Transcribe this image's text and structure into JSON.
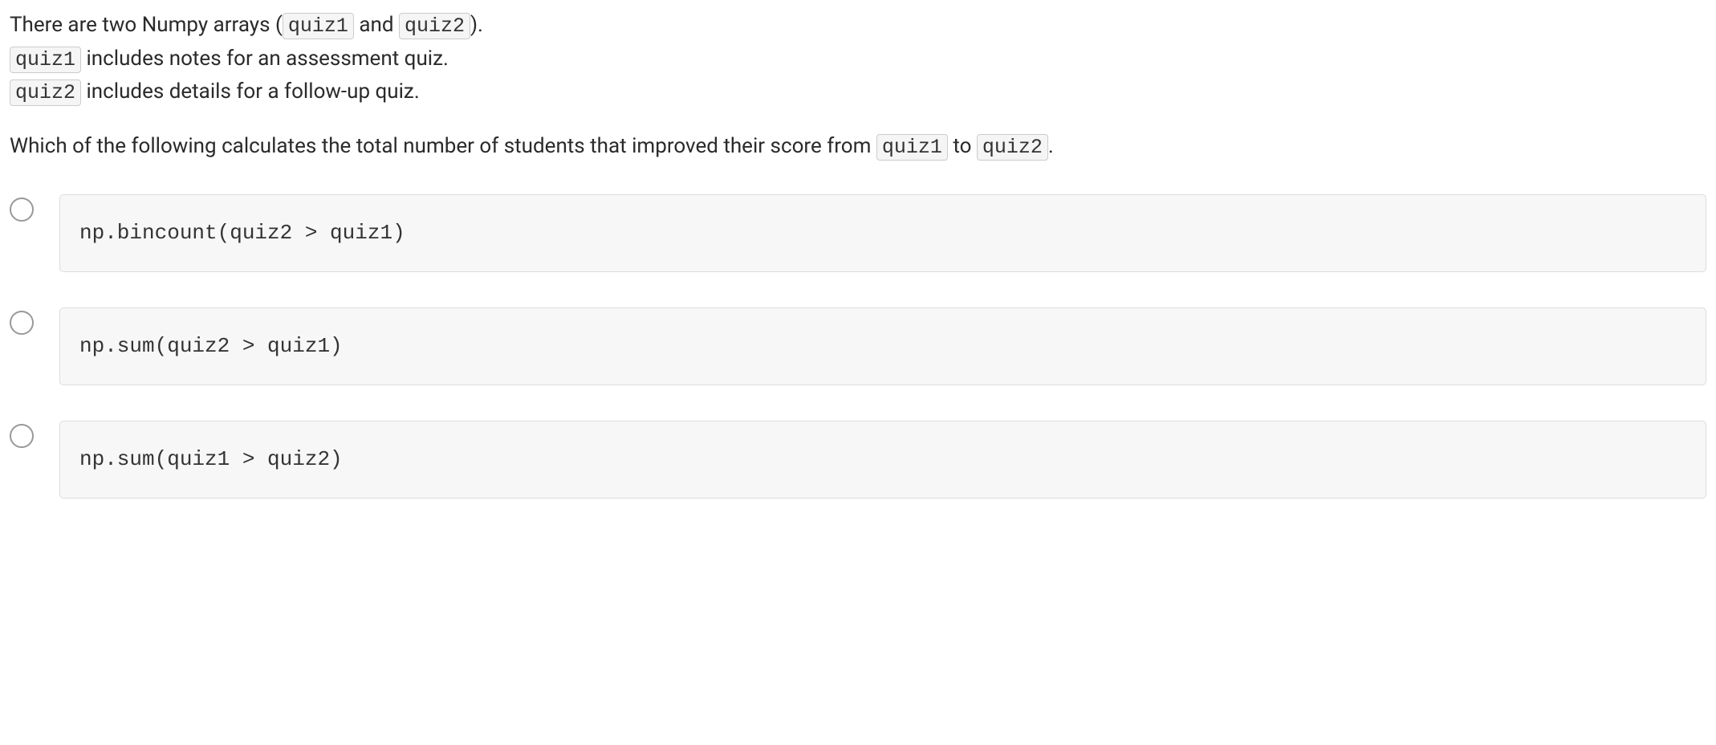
{
  "question": {
    "intro_part1": "There are two Numpy arrays (",
    "intro_code1": "quiz1",
    "intro_part2": " and ",
    "intro_code2": "quiz2",
    "intro_part3": ").",
    "line2_code": "quiz1",
    "line2_text": " includes notes for an assessment quiz.",
    "line3_code": "quiz2",
    "line3_text": " includes details for a follow-up quiz.",
    "prompt_part1": "Which of the following calculates the total number of students that improved their score from ",
    "prompt_code1": "quiz1",
    "prompt_part2": " to ",
    "prompt_code2": "quiz2",
    "prompt_part3": "."
  },
  "options": [
    {
      "code": "np.bincount(quiz2 > quiz1)"
    },
    {
      "code": "np.sum(quiz2 > quiz1)"
    },
    {
      "code": "np.sum(quiz1 > quiz2)"
    }
  ]
}
